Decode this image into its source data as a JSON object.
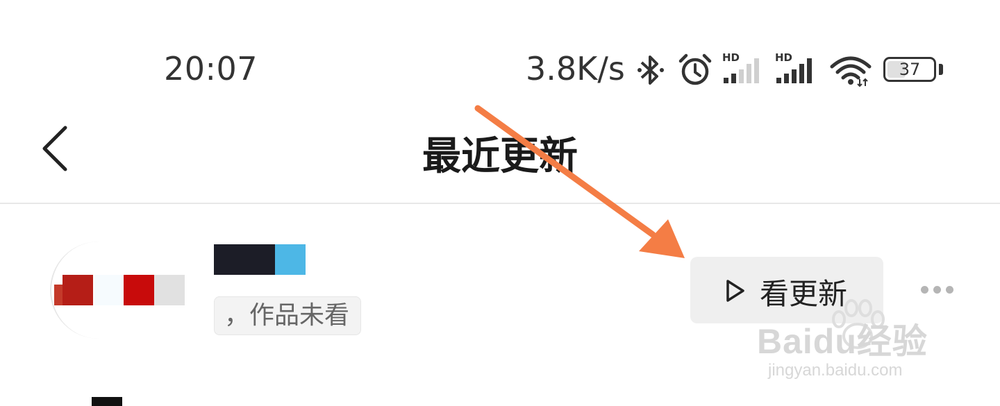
{
  "status_bar": {
    "time": "20:07",
    "network_speed": "3.8K/s",
    "battery_level": "37",
    "icons": [
      "bluetooth-icon",
      "alarm-icon",
      "signal-hd-icon",
      "signal-hd-icon",
      "wifi-icon",
      "battery-icon"
    ],
    "hd_label": "HD"
  },
  "header": {
    "title": "最近更新",
    "back_icon": "chevron-left-icon"
  },
  "list": {
    "items": [
      {
        "unwatched_tag": "，作品未看",
        "action_label": "看更新",
        "action_icon": "play-outline-icon",
        "more_icon": "more-horizontal-icon"
      }
    ]
  },
  "annotation": {
    "arrow_color": "#F47D45"
  },
  "watermark": {
    "brand": "Baidu经验",
    "url": "jingyan.baidu.com"
  }
}
